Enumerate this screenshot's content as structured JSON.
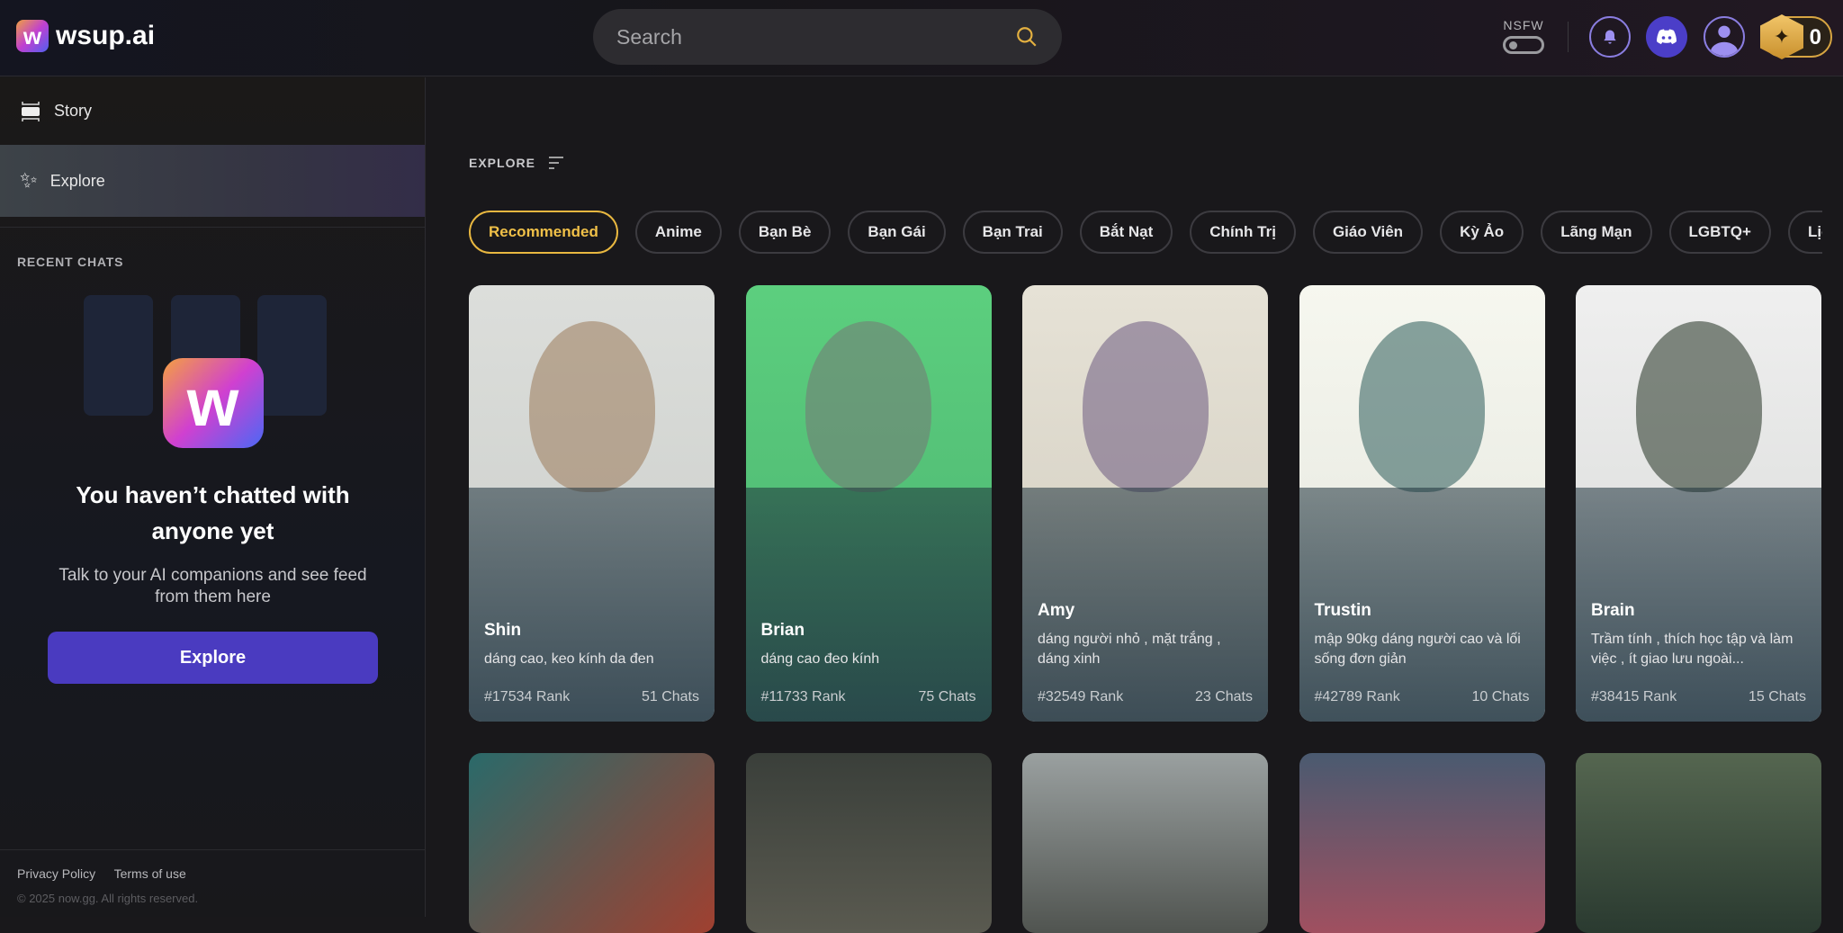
{
  "header": {
    "logo_text": "wsup.ai",
    "search_placeholder": "Search",
    "nsfw_label": "NSFW",
    "coin_count": "0"
  },
  "sidebar": {
    "items": [
      {
        "label": "Story"
      },
      {
        "label": "Explore"
      }
    ],
    "recent_chats_label": "RECENT CHATS",
    "empty": {
      "title": "You haven’t chatted with anyone yet",
      "subtitle": "Talk to your AI companions and see feed from them here",
      "button": "Explore"
    },
    "footer": {
      "privacy": "Privacy Policy",
      "terms": "Terms of use",
      "copyright": "© 2025 now.gg. All rights reserved."
    }
  },
  "main": {
    "section_title": "EXPLORE",
    "chips": [
      "Recommended",
      "Anime",
      "Bạn Bè",
      "Bạn Gái",
      "Bạn Trai",
      "Bắt Nạt",
      "Chính Trị",
      "Giáo Viên",
      "Kỳ Ảo",
      "Lãng Mạn",
      "LGBTQ+",
      "Lịch"
    ],
    "cards": [
      {
        "name": "Shin",
        "desc": "dáng cao, keo kính da đen",
        "rank": "#17534 Rank",
        "chats": "51 Chats"
      },
      {
        "name": "Brian",
        "desc": "dáng cao đeo kính",
        "rank": "#11733 Rank",
        "chats": "75 Chats"
      },
      {
        "name": "Amy",
        "desc": "dáng người nhỏ , mặt trắng , dáng xinh",
        "rank": "#32549 Rank",
        "chats": "23 Chats"
      },
      {
        "name": "Trustin",
        "desc": "mập 90kg dáng người cao và lối sống đơn giản",
        "rank": "#42789 Rank",
        "chats": "10 Chats"
      },
      {
        "name": "Brain",
        "desc": "Trầm tính , thích học tập và làm việc , ít giao lưu ngoài...",
        "rank": "#38415 Rank",
        "chats": "15 Chats"
      }
    ]
  }
}
